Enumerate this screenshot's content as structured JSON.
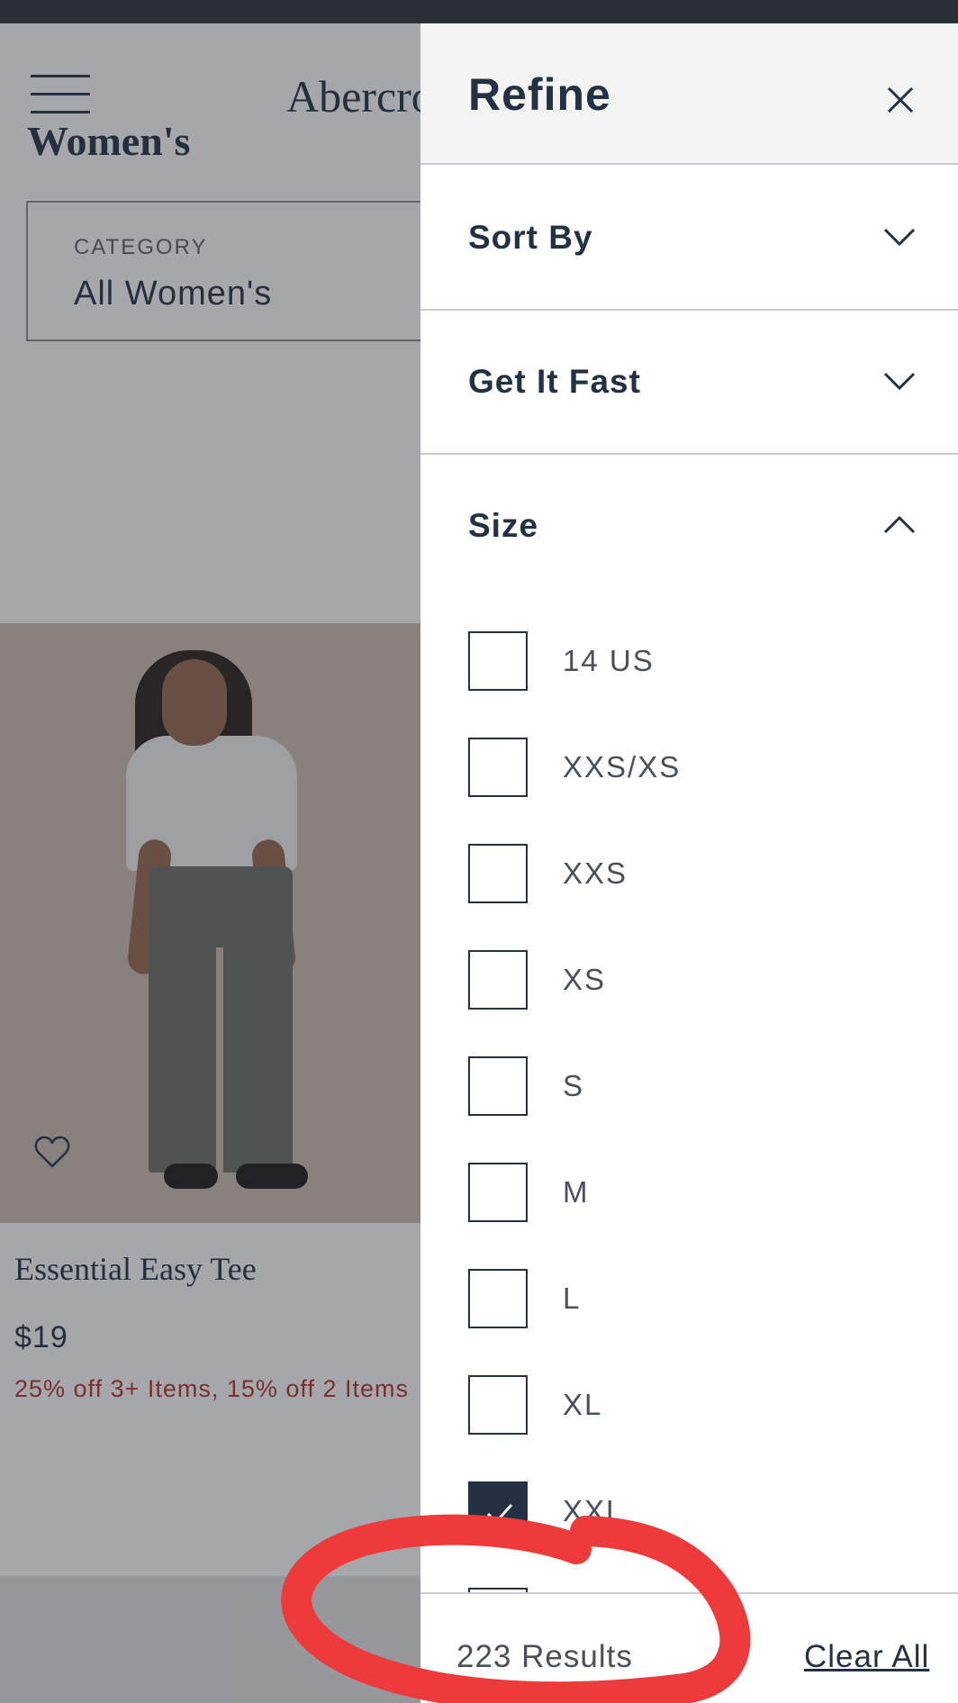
{
  "page": {
    "brand": "Abercrombie & Fitch",
    "title": "Women's",
    "category": {
      "label": "CATEGORY",
      "value": "All Women's"
    }
  },
  "product": {
    "name": "Essential Easy Tee",
    "price": "$19",
    "promo": "25% off 3+ Items, 15% off 2 Items"
  },
  "refine": {
    "title": "Refine",
    "sections": [
      {
        "label": "Sort By",
        "expanded": false
      },
      {
        "label": "Get It Fast",
        "expanded": false
      },
      {
        "label": "Size",
        "expanded": true
      }
    ],
    "size_options": [
      {
        "label": "14 US",
        "checked": false
      },
      {
        "label": "XXS/XS",
        "checked": false
      },
      {
        "label": "XXS",
        "checked": false
      },
      {
        "label": "XS",
        "checked": false
      },
      {
        "label": "S",
        "checked": false
      },
      {
        "label": "M",
        "checked": false
      },
      {
        "label": "L",
        "checked": false
      },
      {
        "label": "XL",
        "checked": false
      },
      {
        "label": "XXL",
        "checked": true
      }
    ],
    "footer": {
      "results": "223 Results",
      "clear_all": "Clear All"
    }
  },
  "colors": {
    "primary_text": "#233142",
    "promo_red": "#b7312b",
    "annotation_red": "#ee3a3a",
    "header_bg": "#f4f4f4"
  }
}
